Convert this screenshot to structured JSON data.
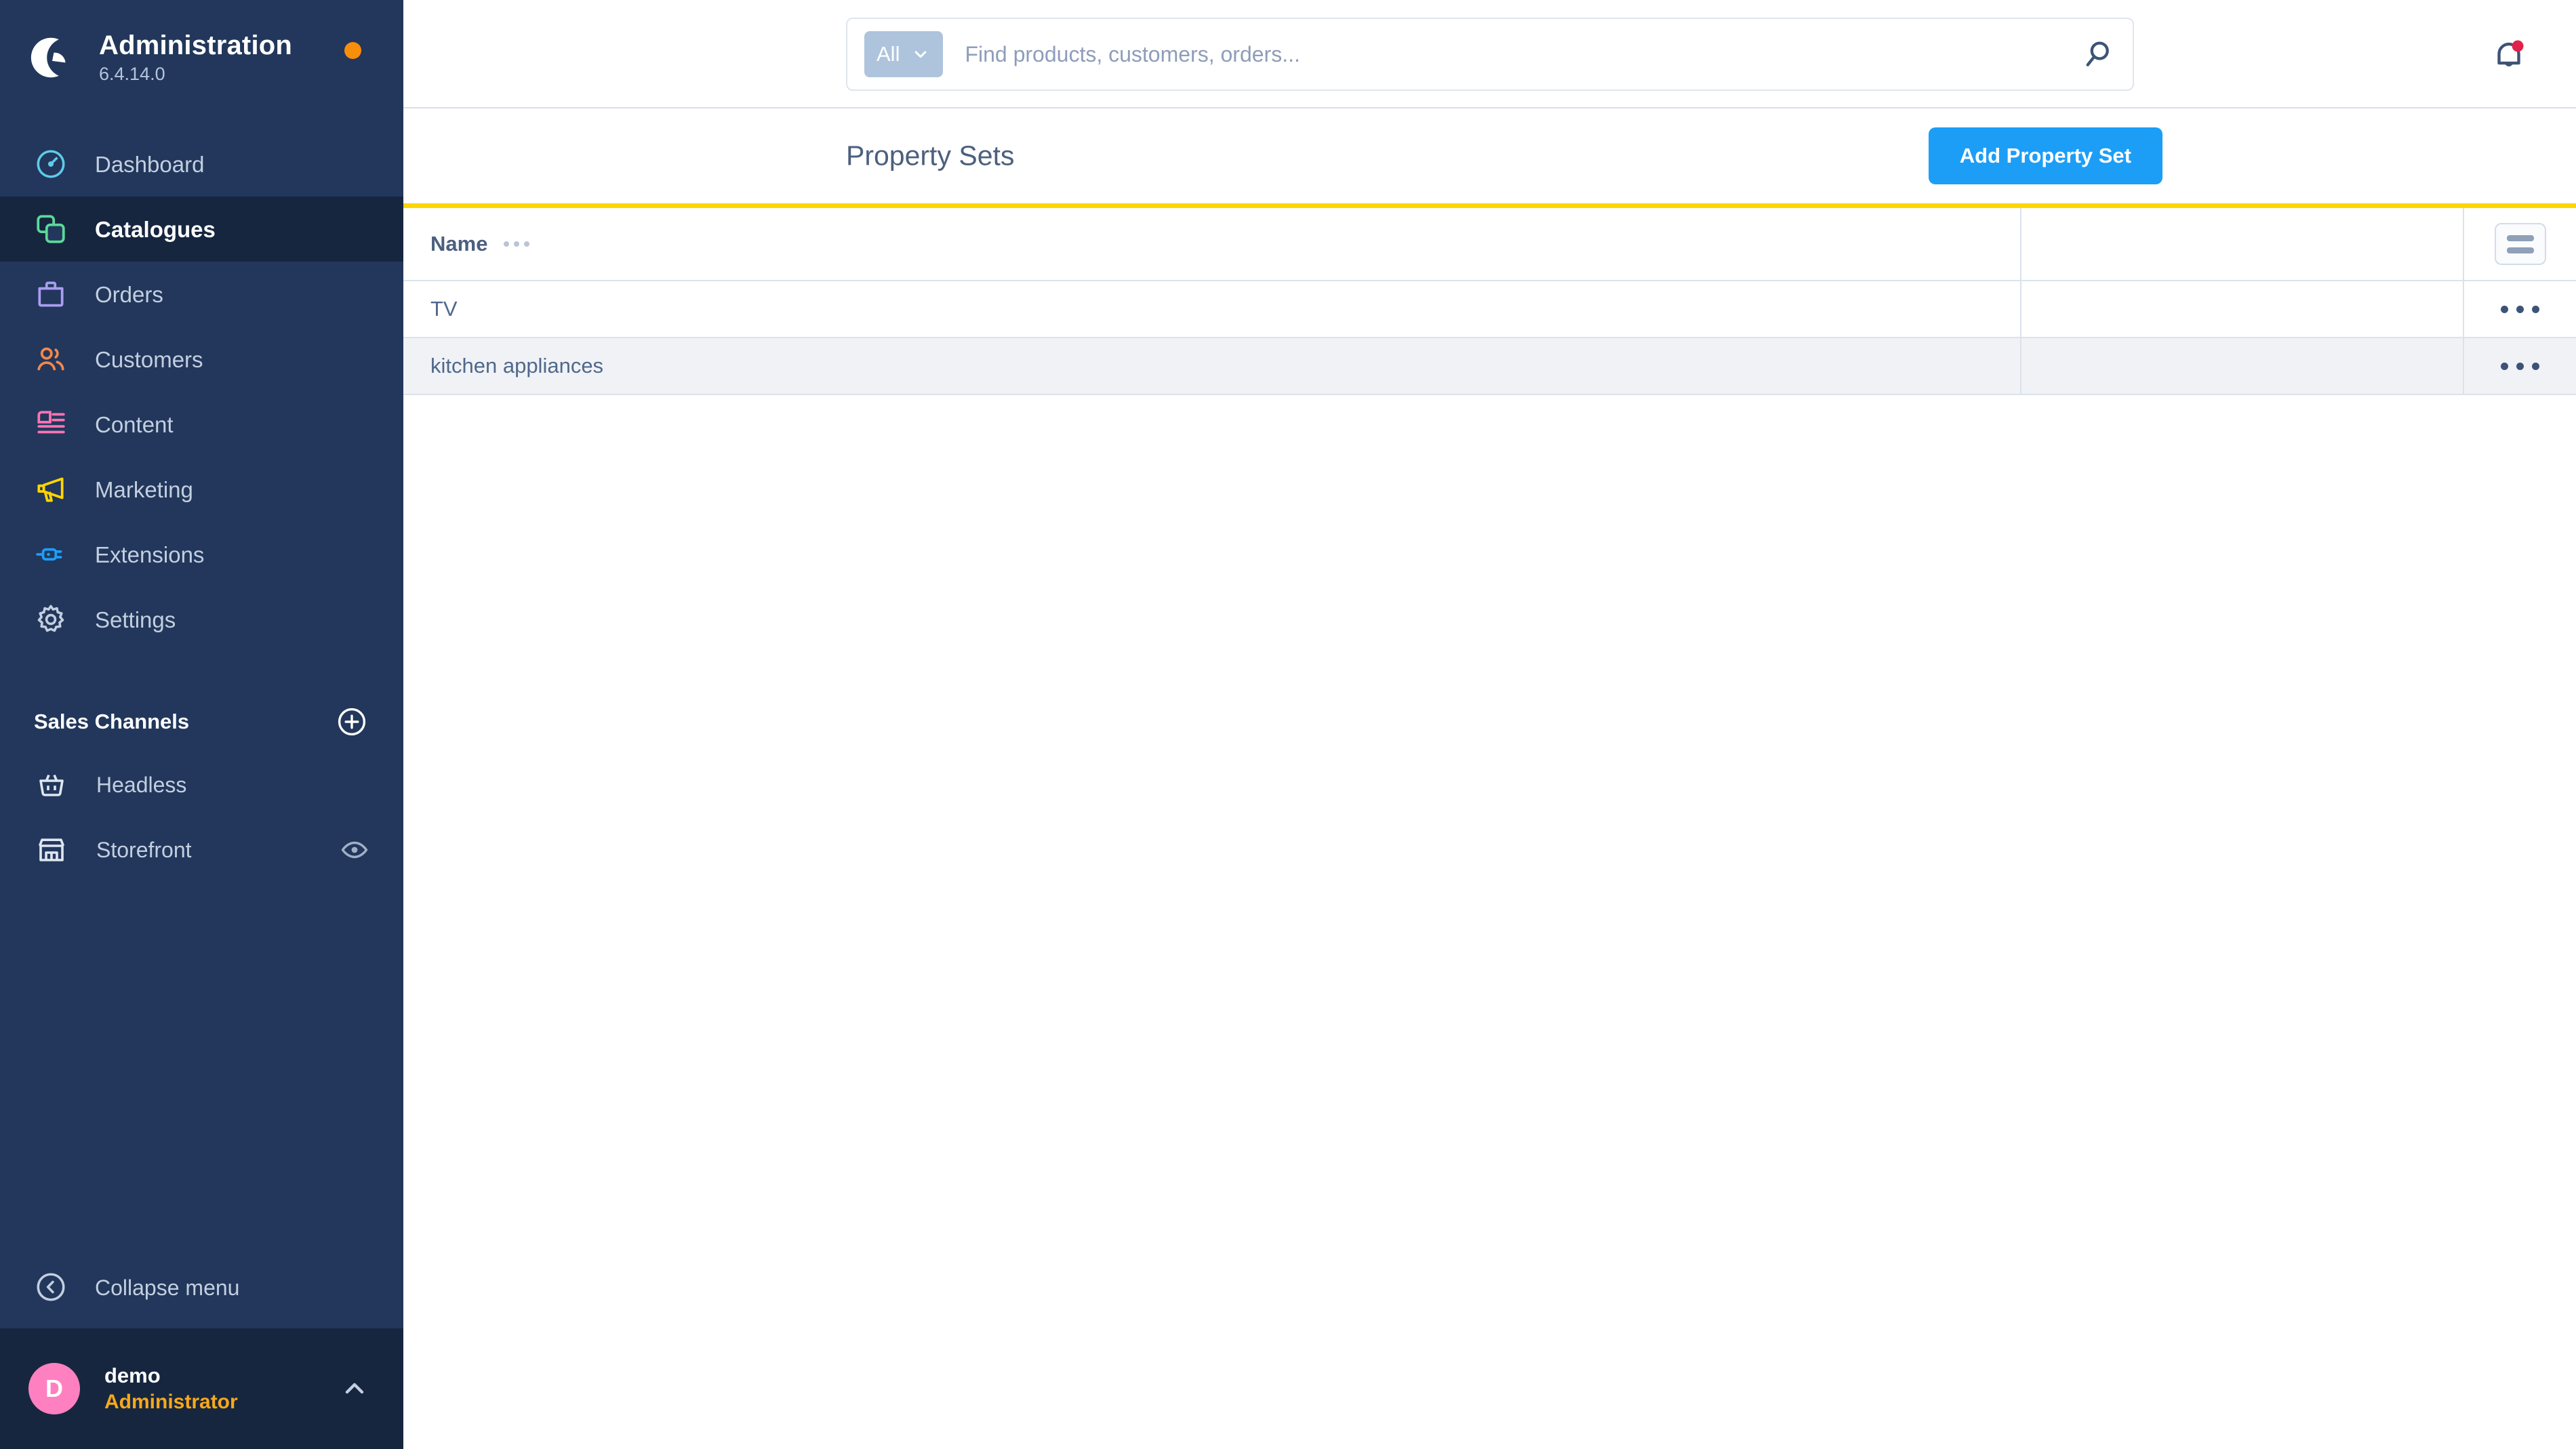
{
  "sidebar": {
    "brand": {
      "title": "Administration",
      "version": "6.4.14.0",
      "logo_icon": "shopware-logo-icon",
      "update_dot": "update-available-dot"
    },
    "nav": [
      {
        "label": "Dashboard",
        "icon": "speedometer-icon",
        "color": "#5ecbe8",
        "active": false
      },
      {
        "label": "Catalogues",
        "icon": "copy-stack-icon",
        "color": "#5bd999",
        "active": true
      },
      {
        "label": "Orders",
        "icon": "bag-icon",
        "color": "#aa9df2",
        "active": false
      },
      {
        "label": "Customers",
        "icon": "users-icon",
        "color": "#f4874b",
        "active": false
      },
      {
        "label": "Content",
        "icon": "layout-lines-icon",
        "color": "#ff73b1",
        "active": false
      },
      {
        "label": "Marketing",
        "icon": "megaphone-icon",
        "color": "#ffd500",
        "active": false
      },
      {
        "label": "Extensions",
        "icon": "plug-icon",
        "color": "#1c9ef7",
        "active": false
      },
      {
        "label": "Settings",
        "icon": "gear-icon",
        "color": "#c3cfe0",
        "active": false
      }
    ],
    "sales_channels": {
      "title": "Sales Channels",
      "add_icon": "plus-circle-icon",
      "items": [
        {
          "label": "Headless",
          "icon": "basket-icon",
          "has_preview": false,
          "preview_icon": ""
        },
        {
          "label": "Storefront",
          "icon": "shop-icon",
          "has_preview": true,
          "preview_icon": "eye-icon"
        }
      ]
    },
    "collapse": {
      "label": "Collapse menu",
      "icon": "chevron-left-circle-icon"
    },
    "user": {
      "initial": "D",
      "name": "demo",
      "role": "Administrator",
      "chevron_icon": "chevron-up-icon",
      "avatar_color": "#ff80c0"
    }
  },
  "topbar": {
    "search": {
      "scope_label": "All",
      "scope_chevron_icon": "chevron-down-icon",
      "value": "",
      "placeholder": "Find products, customers, orders...",
      "submit_icon": "search-icon"
    },
    "notifications": {
      "icon": "bell-icon",
      "has_unread": true,
      "badge_color": "#e0214c"
    }
  },
  "page": {
    "title": "Property Sets",
    "add_button_label": "Add Property Set",
    "accent_color": "#1c9ef7",
    "top_rule_color": "#ffd500"
  },
  "table": {
    "columns": [
      {
        "label": "Name",
        "drag_handle_icon": "drag-dots-icon"
      }
    ],
    "settings_button": {
      "icon": "column-settings-icon"
    },
    "row_action_icon": "context-menu-dots-icon",
    "rows": [
      {
        "name": "TV"
      },
      {
        "name": "kitchen appliances"
      }
    ]
  }
}
